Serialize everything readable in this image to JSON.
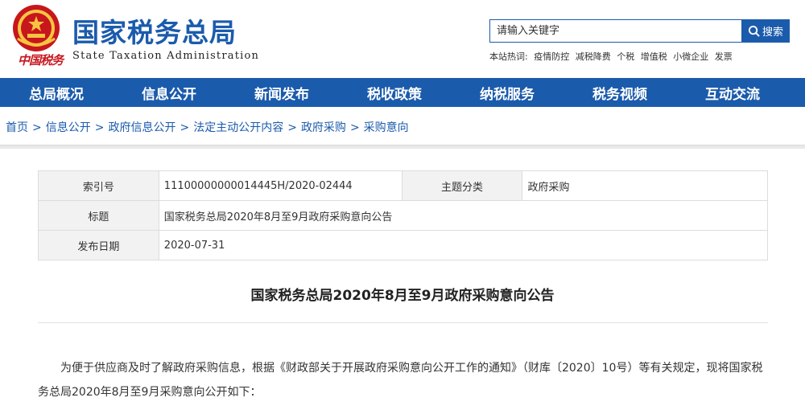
{
  "header": {
    "site_title": "国家税务总局",
    "site_subtitle": "State Taxation Administration",
    "logo_script": "中国税务",
    "brand_color": "#1b5bac",
    "emblem_color": "#c8161d"
  },
  "search": {
    "value": "请输入关键字",
    "button_label": "搜索",
    "hot_label": "本站热词:",
    "hot_words": [
      "疫情防控",
      "减税降费",
      "个税",
      "增值税",
      "小微企业",
      "发票"
    ]
  },
  "nav": {
    "items": [
      "总局概况",
      "信息公开",
      "新闻发布",
      "税收政策",
      "纳税服务",
      "税务视频",
      "互动交流"
    ]
  },
  "breadcrumb": {
    "items": [
      "首页",
      "信息公开",
      "政府信息公开",
      "法定主动公开内容",
      "政府采购",
      "采购意向"
    ],
    "separator": ">"
  },
  "meta": {
    "index_label": "索引号",
    "index_value": "11100000000014445H/2020-02444",
    "topic_label": "主题分类",
    "topic_value": "政府采购",
    "title_label": "标题",
    "title_value": "国家税务总局2020年8月至9月政府采购意向公告",
    "date_label": "发布日期",
    "date_value": "2020-07-31"
  },
  "article": {
    "title": "国家税务总局2020年8月至9月政府采购意向公告",
    "body": "为便于供应商及时了解政府采购信息，根据《财政部关于开展政府采购意向公开工作的通知》（财库〔2020〕10号）等有关规定，现将国家税务总局2020年8月至9月采购意向公开如下："
  }
}
